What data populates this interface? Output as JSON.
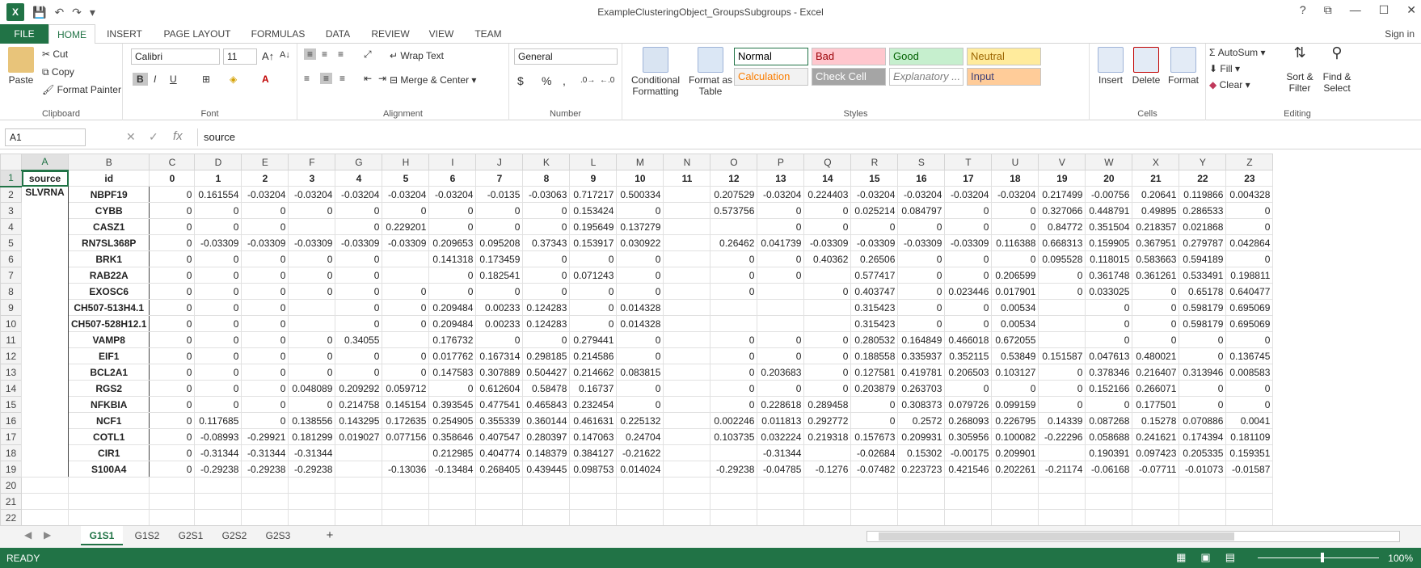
{
  "window": {
    "title": "ExampleClusteringObject_GroupsSubgroups - Excel",
    "help": "?",
    "restore": "⧉",
    "minimize": "—",
    "maximize": "☐",
    "close": "✕",
    "app_letter": "X"
  },
  "qat": {
    "save": "💾",
    "undo": "↶",
    "redo": "↷",
    "customize": "▾"
  },
  "ribbon_tabs": [
    "FILE",
    "HOME",
    "INSERT",
    "PAGE LAYOUT",
    "FORMULAS",
    "DATA",
    "REVIEW",
    "VIEW",
    "TEAM"
  ],
  "active_tab": "HOME",
  "sign_in": "Sign in",
  "ribbon": {
    "clipboard": {
      "paste": "Paste",
      "cut": "Cut",
      "copy": "Copy",
      "format_painter": "Format Painter",
      "label": "Clipboard"
    },
    "font": {
      "name": "Calibri",
      "size": "11",
      "bold": "B",
      "italic": "I",
      "underline": "U",
      "label": "Font"
    },
    "alignment": {
      "wrap_text": "Wrap Text",
      "merge_center": "Merge & Center",
      "label": "Alignment"
    },
    "number": {
      "format": "General",
      "currency": "$",
      "percent": "%",
      "comma": ",",
      "label": "Number"
    },
    "styles": {
      "conditional": "Conditional Formatting",
      "format_table": "Format as Table",
      "cells": [
        {
          "label": "Normal",
          "bg": "#ffffff",
          "fg": "#000000"
        },
        {
          "label": "Bad",
          "bg": "#ffc7ce",
          "fg": "#9c0006"
        },
        {
          "label": "Good",
          "bg": "#c6efce",
          "fg": "#006100"
        },
        {
          "label": "Neutral",
          "bg": "#ffeb9c",
          "fg": "#9c6500"
        },
        {
          "label": "Calculation",
          "bg": "#f2f2f2",
          "fg": "#fa7d00"
        },
        {
          "label": "Check Cell",
          "bg": "#a5a5a5",
          "fg": "#ffffff"
        },
        {
          "label": "Explanatory ...",
          "bg": "#ffffff",
          "fg": "#7f7f7f"
        },
        {
          "label": "Input",
          "bg": "#ffcc99",
          "fg": "#3f3f76"
        }
      ],
      "label": "Styles"
    },
    "cells": {
      "insert": "Insert",
      "delete": "Delete",
      "format": "Format",
      "label": "Cells"
    },
    "editing": {
      "autosum": "AutoSum",
      "fill": "Fill",
      "clear": "Clear",
      "sort_filter": "Sort & Filter",
      "find_select": "Find & Select",
      "label": "Editing"
    }
  },
  "formula_bar": {
    "name_box": "A1",
    "fx": "fx",
    "content": "source"
  },
  "columns": [
    "A",
    "B",
    "C",
    "D",
    "E",
    "F",
    "G",
    "H",
    "I",
    "J",
    "K",
    "L",
    "M",
    "N",
    "O",
    "P",
    "Q",
    "R",
    "S",
    "T",
    "U",
    "V",
    "W",
    "X",
    "Y",
    "Z"
  ],
  "header_row": [
    "source",
    "id",
    "0",
    "1",
    "2",
    "3",
    "4",
    "5",
    "6",
    "7",
    "8",
    "9",
    "10",
    "11",
    "12",
    "13",
    "14",
    "15",
    "16",
    "17",
    "18",
    "19",
    "20",
    "21",
    "22",
    "23"
  ],
  "source_label": "SLVRNA",
  "rows": [
    [
      "NBPF19",
      "0",
      "0.161554",
      "-0.03204",
      "-0.03204",
      "-0.03204",
      "-0.03204",
      "-0.03204",
      "-0.0135",
      "-0.03063",
      "0.717217",
      "0.500334",
      "",
      "0.207529",
      "-0.03204",
      "0.224403",
      "-0.03204",
      "-0.03204",
      "-0.03204",
      "-0.03204",
      "0.217499",
      "-0.00756",
      "0.20641",
      "0.119866",
      "0.004328"
    ],
    [
      "CYBB",
      "0",
      "0",
      "0",
      "0",
      "0",
      "0",
      "0",
      "0",
      "0",
      "0.153424",
      "0",
      "",
      "0.573756",
      "0",
      "0",
      "0.025214",
      "0.084797",
      "0",
      "0",
      "0.327066",
      "0.448791",
      "0.49895",
      "0.286533",
      "0"
    ],
    [
      "CASZ1",
      "0",
      "0",
      "0",
      "",
      "0",
      "0.229201",
      "0",
      "0",
      "0",
      "0.195649",
      "0.137279",
      "",
      "",
      "0",
      "0",
      "0",
      "0",
      "0",
      "0",
      "0.84772",
      "0.351504",
      "0.218357",
      "0.021868",
      "0"
    ],
    [
      "RN7SL368P",
      "0",
      "-0.03309",
      "-0.03309",
      "-0.03309",
      "-0.03309",
      "-0.03309",
      "0.209653",
      "0.095208",
      "0.37343",
      "0.153917",
      "0.030922",
      "",
      "0.26462",
      "0.041739",
      "-0.03309",
      "-0.03309",
      "-0.03309",
      "-0.03309",
      "0.116388",
      "0.668313",
      "0.159905",
      "0.367951",
      "0.279787",
      "0.042864"
    ],
    [
      "BRK1",
      "0",
      "0",
      "0",
      "0",
      "0",
      "",
      "0.141318",
      "0.173459",
      "0",
      "0",
      "0",
      "",
      "0",
      "0",
      "0.40362",
      "0.26506",
      "0",
      "0",
      "0",
      "0.095528",
      "0.118015",
      "0.583663",
      "0.594189",
      "0"
    ],
    [
      "RAB22A",
      "0",
      "0",
      "0",
      "0",
      "0",
      "",
      "0",
      "0.182541",
      "0",
      "0.071243",
      "0",
      "",
      "0",
      "0",
      "",
      "0.577417",
      "0",
      "0",
      "0.206599",
      "0",
      "0.361748",
      "0.361261",
      "0.533491",
      "0.198811"
    ],
    [
      "EXOSC6",
      "0",
      "0",
      "0",
      "0",
      "0",
      "0",
      "0",
      "0",
      "0",
      "0",
      "0",
      "",
      "0",
      "",
      "0",
      "0.403747",
      "0",
      "0.023446",
      "0.017901",
      "0",
      "0.033025",
      "0",
      "0.65178",
      "0.640477"
    ],
    [
      "CH507-513H4.1",
      "0",
      "0",
      "0",
      "",
      "0",
      "0",
      "0.209484",
      "0.00233",
      "0.124283",
      "0",
      "0.014328",
      "",
      "",
      "",
      "",
      "0.315423",
      "0",
      "0",
      "0.00534",
      "",
      "0",
      "0",
      "0.598179",
      "0.695069"
    ],
    [
      "CH507-528H12.1",
      "0",
      "0",
      "0",
      "",
      "0",
      "0",
      "0.209484",
      "0.00233",
      "0.124283",
      "0",
      "0.014328",
      "",
      "",
      "",
      "",
      "0.315423",
      "0",
      "0",
      "0.00534",
      "",
      "0",
      "0",
      "0.598179",
      "0.695069"
    ],
    [
      "VAMP8",
      "0",
      "0",
      "0",
      "0",
      "0.34055",
      "",
      "0.176732",
      "0",
      "0",
      "0.279441",
      "0",
      "",
      "0",
      "0",
      "0",
      "0.280532",
      "0.164849",
      "0.466018",
      "0.672055",
      "",
      "0",
      "0",
      "0",
      "0"
    ],
    [
      "EIF1",
      "0",
      "0",
      "0",
      "0",
      "0",
      "0",
      "0.017762",
      "0.167314",
      "0.298185",
      "0.214586",
      "0",
      "",
      "0",
      "0",
      "0",
      "0.188558",
      "0.335937",
      "0.352115",
      "0.53849",
      "0.151587",
      "0.047613",
      "0.480021",
      "0",
      "0.136745"
    ],
    [
      "BCL2A1",
      "0",
      "0",
      "0",
      "0",
      "0",
      "0",
      "0.147583",
      "0.307889",
      "0.504427",
      "0.214662",
      "0.083815",
      "",
      "0",
      "0.203683",
      "0",
      "0.127581",
      "0.419781",
      "0.206503",
      "0.103127",
      "0",
      "0.378346",
      "0.216407",
      "0.313946",
      "0.008583"
    ],
    [
      "RGS2",
      "0",
      "0",
      "0",
      "0.048089",
      "0.209292",
      "0.059712",
      "0",
      "0.612604",
      "0.58478",
      "0.16737",
      "0",
      "",
      "0",
      "0",
      "0",
      "0.203879",
      "0.263703",
      "0",
      "0",
      "0",
      "0.152166",
      "0.266071",
      "0",
      "0"
    ],
    [
      "NFKBIA",
      "0",
      "0",
      "0",
      "0",
      "0.214758",
      "0.145154",
      "0.393545",
      "0.477541",
      "0.465843",
      "0.232454",
      "0",
      "",
      "0",
      "0.228618",
      "0.289458",
      "0",
      "0.308373",
      "0.079726",
      "0.099159",
      "0",
      "0",
      "0.177501",
      "0",
      "0"
    ],
    [
      "NCF1",
      "0",
      "0.117685",
      "0",
      "0.138556",
      "0.143295",
      "0.172635",
      "0.254905",
      "0.355339",
      "0.360144",
      "0.461631",
      "0.225132",
      "",
      "0.002246",
      "0.011813",
      "0.292772",
      "0",
      "0.2572",
      "0.268093",
      "0.226795",
      "0.14339",
      "0.087268",
      "0.15278",
      "0.070886",
      "0.0041"
    ],
    [
      "COTL1",
      "0",
      "-0.08993",
      "-0.29921",
      "0.181299",
      "0.019027",
      "0.077156",
      "0.358646",
      "0.407547",
      "0.280397",
      "0.147063",
      "0.24704",
      "",
      "0.103735",
      "0.032224",
      "0.219318",
      "0.157673",
      "0.209931",
      "0.305956",
      "0.100082",
      "-0.22296",
      "0.058688",
      "0.241621",
      "0.174394",
      "0.181109"
    ],
    [
      "CIR1",
      "0",
      "-0.31344",
      "-0.31344",
      "-0.31344",
      "",
      "",
      "0.212985",
      "0.404774",
      "0.148379",
      "0.384127",
      "-0.21622",
      "",
      "",
      "-0.31344",
      "",
      "-0.02684",
      "0.15302",
      "-0.00175",
      "0.209901",
      "",
      "0.190391",
      "0.097423",
      "0.205335",
      "0.159351"
    ],
    [
      "S100A4",
      "0",
      "-0.29238",
      "-0.29238",
      "-0.29238",
      "",
      "-0.13036",
      "-0.13484",
      "0.268405",
      "0.439445",
      "0.098753",
      "0.014024",
      "",
      "-0.29238",
      "-0.04785",
      "-0.1276",
      "-0.07482",
      "0.223723",
      "0.421546",
      "0.202261",
      "-0.21174",
      "-0.06168",
      "-0.07711",
      "-0.01073",
      "-0.01587"
    ]
  ],
  "row_numbers": [
    "1",
    "2",
    "3",
    "4",
    "5",
    "6",
    "7",
    "8",
    "9",
    "10",
    "11",
    "12",
    "13",
    "14",
    "15",
    "16",
    "17",
    "18",
    "19",
    "20",
    "21",
    "22"
  ],
  "sheet_tabs": [
    "G1S1",
    "G1S2",
    "G2S1",
    "G2S2",
    "G2S3"
  ],
  "active_sheet": "G1S1",
  "add_sheet": "+",
  "status": {
    "ready": "READY",
    "zoom": "100%"
  }
}
